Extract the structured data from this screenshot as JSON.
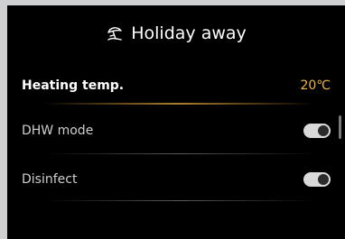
{
  "header": {
    "title": "Holiday away",
    "icon": "beach-umbrella-icon"
  },
  "settings": {
    "heating_temp": {
      "label": "Heating temp.",
      "value": "20℃"
    },
    "dhw_mode": {
      "label": "DHW mode",
      "state": "off"
    },
    "disinfect": {
      "label": "Disinfect",
      "state": "off"
    }
  },
  "colors": {
    "background": "#000000",
    "accent": "#f0b640",
    "toggle_track": "#d9d9d9"
  }
}
